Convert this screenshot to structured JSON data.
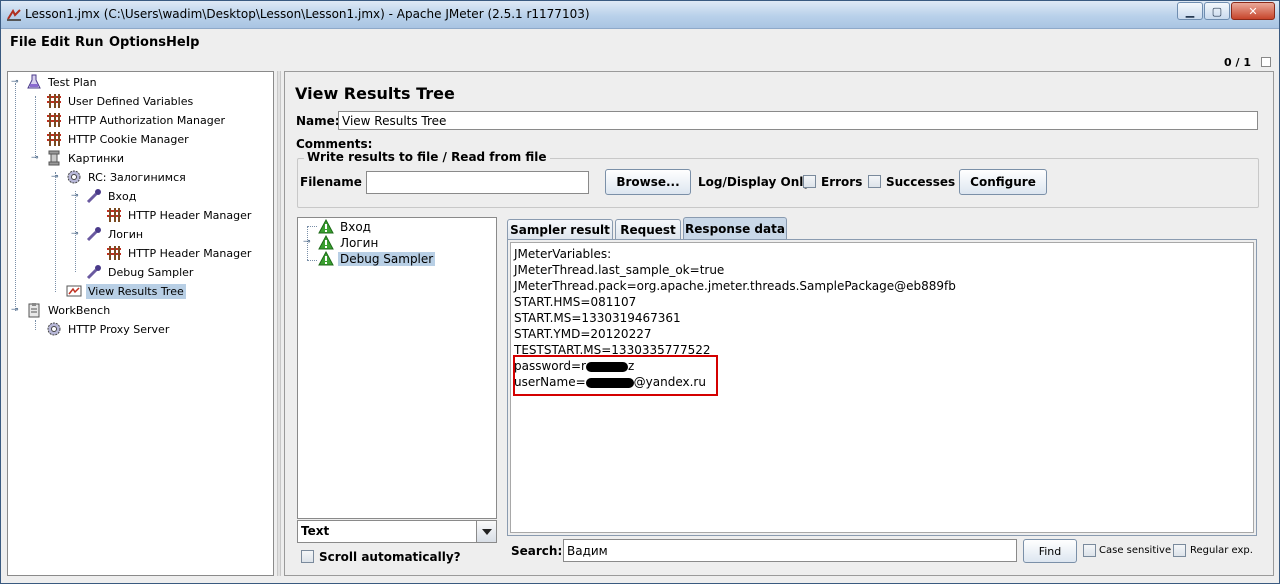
{
  "window": {
    "title": "Lesson1.jmx (C:\\Users\\wadim\\Desktop\\Lesson\\Lesson1.jmx) - Apache JMeter (2.5.1 r1177103)",
    "minimize": "▁",
    "maximize": "▢",
    "close": "✕"
  },
  "menu": [
    {
      "label": "File"
    },
    {
      "label": "Edit"
    },
    {
      "label": "Run"
    },
    {
      "label": "Options"
    },
    {
      "label": "Help"
    }
  ],
  "counter": "0 / 1",
  "tree": {
    "test_plan": "Test Plan",
    "user_defined_variables": "User Defined Variables",
    "http_authorization_manager": "HTTP Authorization Manager",
    "http_cookie_manager": "HTTP Cookie Manager",
    "kartinki": "Картинки",
    "rc_zaloginimsya": "RC: Залогинимся",
    "vhod": "Вход",
    "http_header_manager_1": "HTTP Header Manager",
    "login": "Логин",
    "http_header_manager_2": "HTTP Header Manager",
    "debug_sampler": "Debug Sampler",
    "view_results_tree": "View Results Tree",
    "workbench": "WorkBench",
    "http_proxy_server": "HTTP Proxy Server"
  },
  "panel": {
    "title": "View Results Tree",
    "name_label": "Name:",
    "name_value": "View Results Tree",
    "comments_label": "Comments:",
    "group_title": "Write results to file / Read from file",
    "filename_label": "Filename",
    "filename_value": "",
    "browse_button": "Browse...",
    "log_display_label": "Log/Display Only:",
    "errors_label": "Errors",
    "successes_label": "Successes",
    "configure_button": "Configure"
  },
  "results": {
    "items": [
      "Вход",
      "Логин",
      "Debug Sampler"
    ],
    "renderer": "Text",
    "scroll_auto_label": "Scroll automatically?"
  },
  "tabs": [
    "Sampler result",
    "Request",
    "Response data"
  ],
  "response": {
    "lines": [
      "JMeterVariables:",
      "JMeterThread.last_sample_ok=true",
      "JMeterThread.pack=org.apache.jmeter.threads.SamplePackage@eb889fb",
      "START.HMS=081107",
      "START.MS=1330319467361",
      "START.YMD=20120227",
      "TESTSTART.MS=1330335777522"
    ],
    "password_prefix": "password=r",
    "password_suffix": "z",
    "username_prefix": "userName=",
    "username_suffix": "@yandex.ru"
  },
  "search": {
    "label": "Search:",
    "value": "Вадим",
    "find_button": "Find",
    "case_sensitive_label": "Case sensitive",
    "regex_label": "Regular exp."
  },
  "colors": {
    "selection": "#b8cfe5",
    "highlight_border": "#d40000"
  }
}
